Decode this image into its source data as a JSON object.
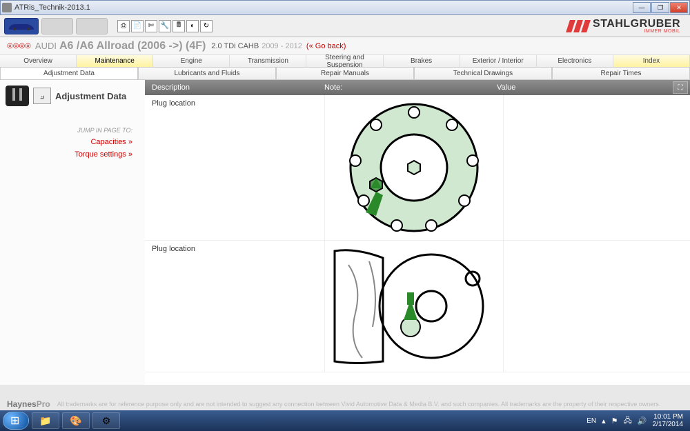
{
  "window": {
    "title": "ATRis_Technik-2013.1"
  },
  "brand": {
    "name": "STAHLGRUBER",
    "sub": "IMMER MOBIL"
  },
  "vehicle": {
    "make": "AUDI",
    "model": "A6 /A6 Allroad (2006 ->) (4F)",
    "engine": "2.0 TDi CAHB",
    "years": "2009 - 2012",
    "goback": "(« Go back)"
  },
  "tabs1": [
    "Overview",
    "Maintenance",
    "Engine",
    "Transmission",
    "Steering and Suspension",
    "Brakes",
    "Exterior / Interior",
    "Electronics",
    "Index"
  ],
  "tabs1_active_index": 1,
  "tabs1_yellow_index": 8,
  "tabs2": [
    "Adjustment Data",
    "Lubricants and Fluids",
    "Repair Manuals",
    "Technical Drawings",
    "Repair Times"
  ],
  "tabs2_active_index": 0,
  "sidebar": {
    "title": "Adjustment Data",
    "jump_label": "JUMP IN PAGE TO:",
    "links": [
      "Capacities  »",
      "Torque settings  »"
    ]
  },
  "columns": {
    "c1": "Description",
    "c2": "Note:",
    "c3": "Value"
  },
  "rows": [
    {
      "desc": "Plug location"
    },
    {
      "desc": "Plug location"
    }
  ],
  "footer": {
    "brand1": "Haynes",
    "brand2": "Pro",
    "disclaimer": "All trademarks are for reference purpose only and are not intended to suggest any connection between Vivid Automotive Data & Media B.V. and such companies. All trademarks are the property of their respective owners."
  },
  "taskbar": {
    "lang": "EN",
    "time": "10:01 PM",
    "date": "2/17/2014"
  }
}
